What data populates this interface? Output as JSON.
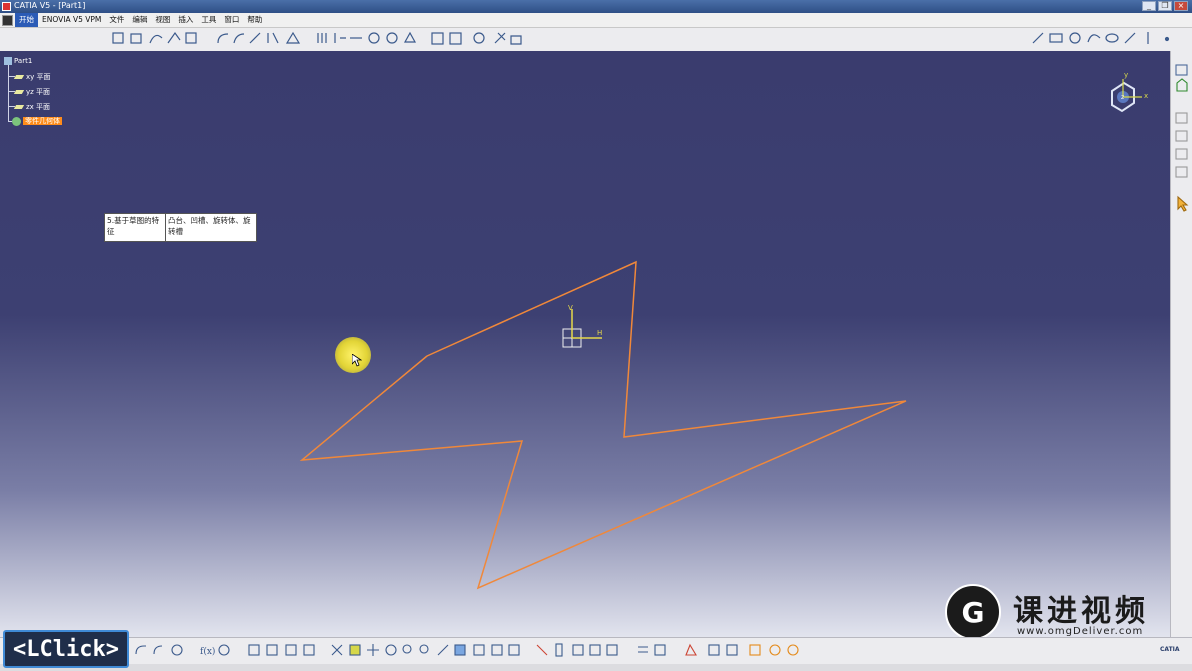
{
  "window": {
    "title": "CATIA V5 - [Part1]"
  },
  "menu": {
    "items": [
      "开始",
      "ENOVIA V5 VPM",
      "文件",
      "编辑",
      "视图",
      "插入",
      "工具",
      "窗口",
      "帮助"
    ]
  },
  "tree": {
    "root": "Part1",
    "planes": [
      "xy 平面",
      "yz 平面",
      "zx 平面"
    ],
    "body": "零件几何体"
  },
  "callout": {
    "col1": "5.基于草图的特征",
    "col2": "凸台、凹槽、旋转体、旋转槽"
  },
  "sketch": {
    "axis_v": "V",
    "axis_h": "H",
    "line_color": "#f0883a"
  },
  "compass": {
    "x": "x",
    "y": "y",
    "z": "z"
  },
  "overlay": {
    "click_label": "<LClick>"
  },
  "brand": {
    "name": "课进视频",
    "url": "www.omgDeliver.com",
    "logo_letter": "G"
  },
  "colors": {
    "viewport_top": "#3a3c6e",
    "highlight": "#ff8c1a",
    "sketch": "#f0883a"
  }
}
